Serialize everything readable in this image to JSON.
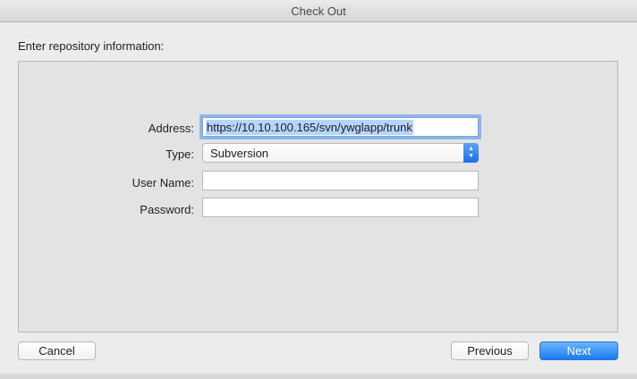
{
  "window": {
    "title": "Check Out"
  },
  "form": {
    "instruction": "Enter repository information:",
    "address_label": "Address:",
    "address_value": "https://10.10.100.165/svn/ywglapp/trunk",
    "type_label": "Type:",
    "type_value": "Subversion",
    "username_label": "User Name:",
    "username_value": "",
    "password_label": "Password:",
    "password_value": ""
  },
  "buttons": {
    "cancel": "Cancel",
    "previous": "Previous",
    "next": "Next"
  },
  "colors": {
    "accent": "#197cf1",
    "selection": "#b5d5ff"
  }
}
